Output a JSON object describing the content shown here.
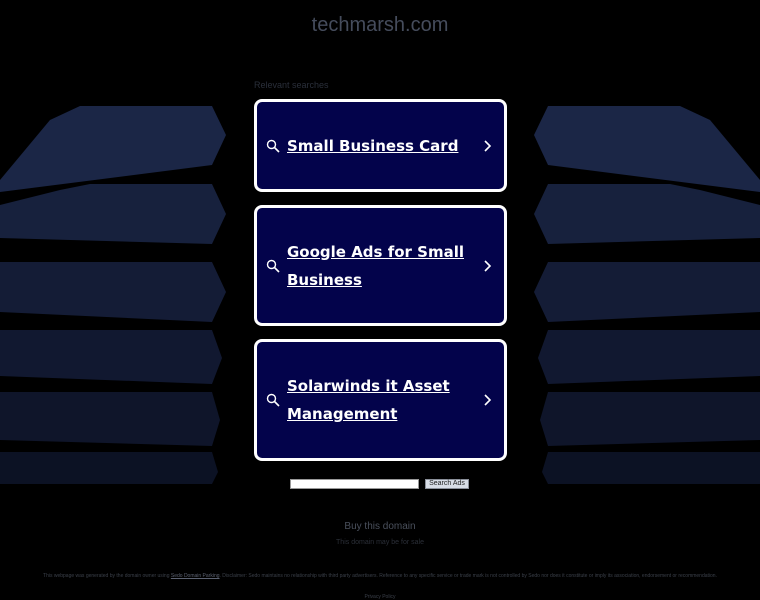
{
  "header": {
    "domain": "techmarsh.com"
  },
  "related": {
    "label": "Relevant searches",
    "items": [
      {
        "label": "Small Business Card"
      },
      {
        "label": "Google Ads for Small Business"
      },
      {
        "label": "Solarwinds it Asset Management"
      }
    ]
  },
  "search": {
    "placeholder": "",
    "button_label": "Search Ads"
  },
  "footer": {
    "buy_label": "Buy this domain",
    "sale_text": "This domain may be for sale",
    "disclaimer_prefix": "This webpage was generated by the domain owner using",
    "disclaimer_link": "Sedo Domain Parking",
    "disclaimer_suffix": ". Disclaimer: Sedo maintains no relationship with third party advertisers. Reference to any specific service or trade mark is not controlled by Sedo nor does it constitute or imply its association, endorsement or recommendation.",
    "privacy_label": "Privacy Policy"
  },
  "colors": {
    "card_bg": "#03034b",
    "card_border": "#ffffff",
    "page_bg": "#000000"
  }
}
